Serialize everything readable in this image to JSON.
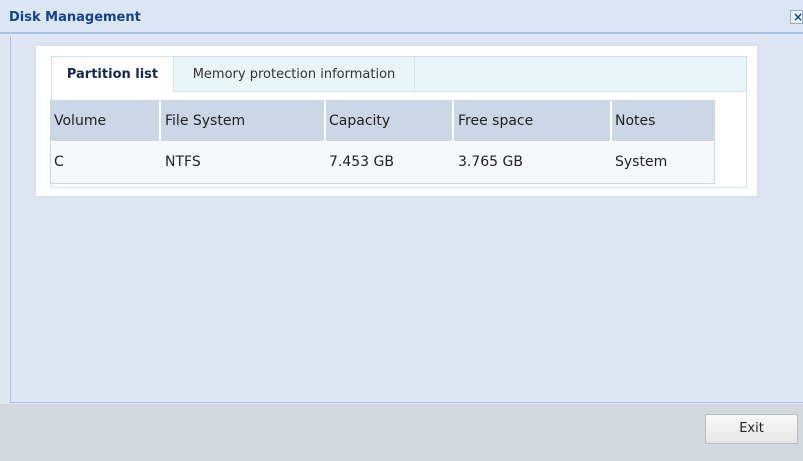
{
  "window": {
    "title": "Disk Management",
    "close_glyph": "×"
  },
  "tabs": [
    {
      "label": "Partition list",
      "active": true
    },
    {
      "label": "Memory protection information",
      "active": false
    }
  ],
  "table": {
    "columns": [
      "Volume",
      "File System",
      "Capacity",
      "Free space",
      "Notes"
    ],
    "rows": [
      [
        "C",
        "NTFS",
        "7.453 GB",
        "3.765 GB",
        "System"
      ]
    ]
  },
  "footer": {
    "exit_label": "Exit"
  }
}
